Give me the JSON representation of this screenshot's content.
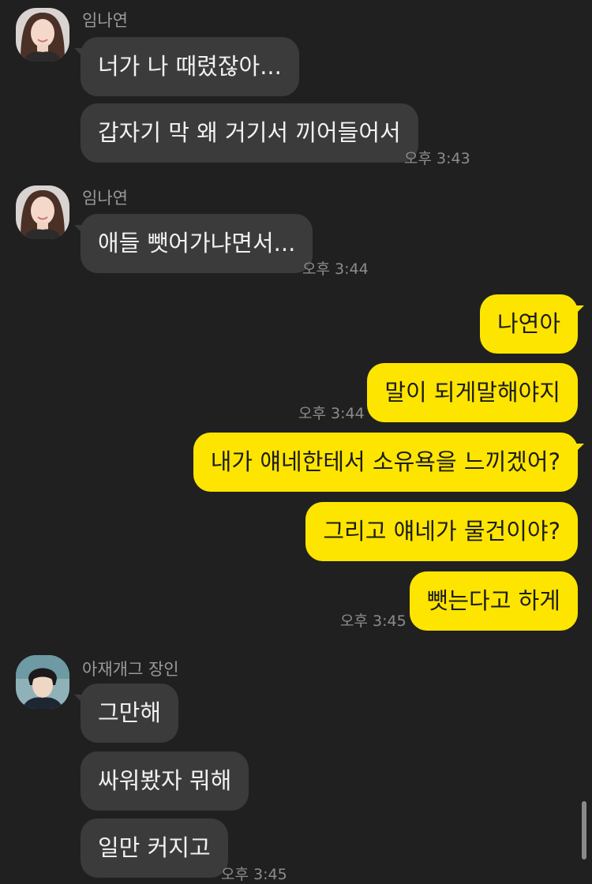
{
  "chat": {
    "sender_1": "임나연",
    "sender_2": "아재개그 장인",
    "time_343": "오후 3:43",
    "time_344": "오후 3:44",
    "time_345": "오후 3:45",
    "messages": [
      {
        "text": "너가 나 때렸잖아..."
      },
      {
        "text": "갑자기 막 왜 거기서 끼어들어서"
      },
      {
        "text": "애들 뺏어가냐면서..."
      },
      {
        "text": "나연아"
      },
      {
        "text": "말이 되게말해야지"
      },
      {
        "text": "내가 얘네한테서 소유욕을 느끼겠어?"
      },
      {
        "text": "그리고 얘네가 물건이야?"
      },
      {
        "text": "뺏는다고 하게"
      },
      {
        "text": "그만해"
      },
      {
        "text": "싸워봤자 뭐해"
      },
      {
        "text": "일만 커지고"
      }
    ]
  },
  "colors": {
    "background": "#202020",
    "incoming_bubble": "#3b3b3b",
    "outgoing_bubble": "#fee500"
  },
  "icons": {
    "avatar_1": "avatar-nayeon",
    "avatar_2": "avatar-jin"
  }
}
